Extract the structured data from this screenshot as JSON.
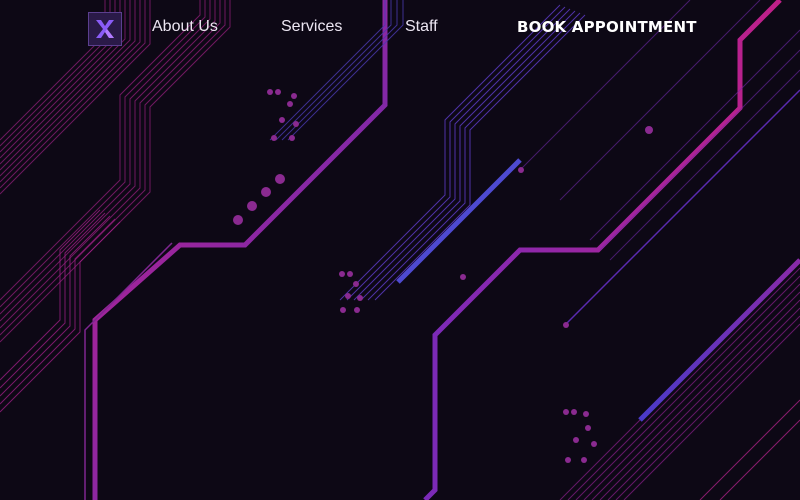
{
  "nav": {
    "logo_icon": "x-logo-icon",
    "links": [
      {
        "label": "About Us"
      },
      {
        "label": "Services"
      },
      {
        "label": "Staff"
      }
    ],
    "cta_label": "BOOK APPOINTMENT"
  },
  "colors": {
    "background": "#0d0815",
    "accent_magenta": "#b0208a",
    "accent_purple": "#6a3fd0",
    "logo_purple": "#8a5cf6"
  }
}
